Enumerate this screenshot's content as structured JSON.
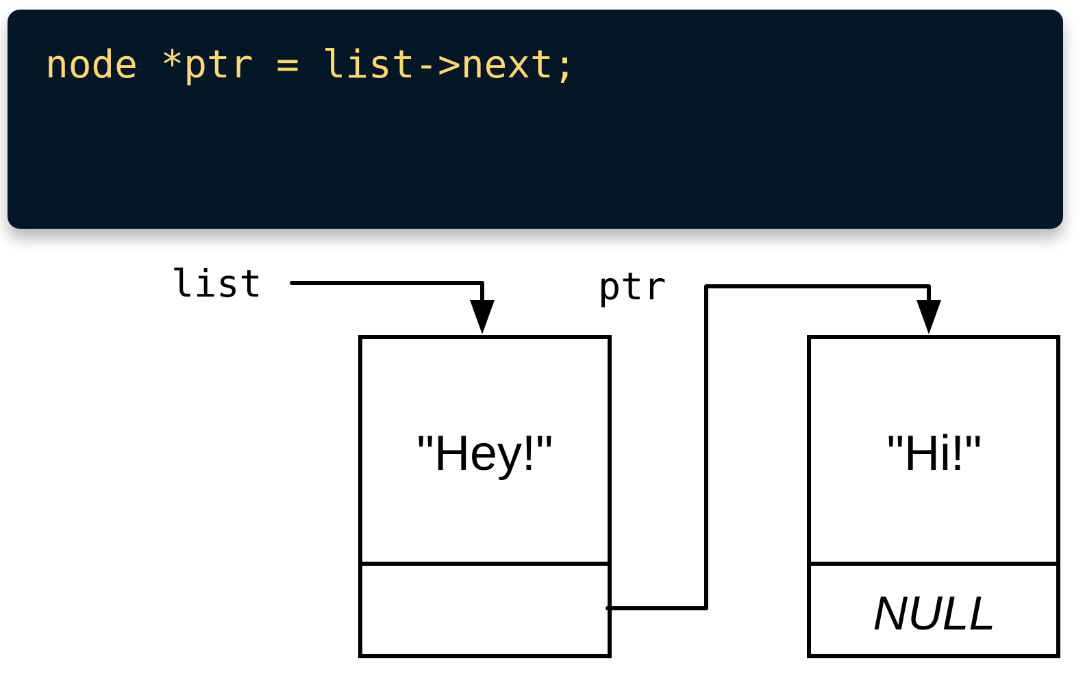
{
  "code": {
    "line": "node *ptr = list->next;",
    "text_color": "#ffd876",
    "background_color": "#031626"
  },
  "diagram": {
    "labels": {
      "list": "list",
      "ptr": "ptr"
    },
    "nodes": [
      {
        "value": "\"Hey!\"",
        "next": ""
      },
      {
        "value": "\"Hi!\"",
        "next": "NULL"
      }
    ]
  }
}
